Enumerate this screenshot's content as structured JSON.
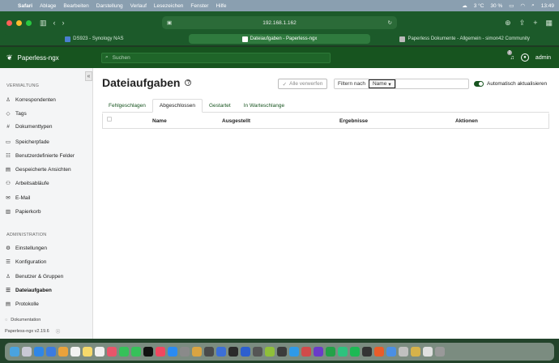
{
  "menubar": {
    "app": "Safari",
    "items": [
      "Ablage",
      "Bearbeiten",
      "Darstellung",
      "Verlauf",
      "Lesezeichen",
      "Fenster",
      "Hilfe"
    ],
    "weather": "3 °C",
    "battery": "30 %",
    "time": "13:49"
  },
  "browser": {
    "url": "192.168.1.162",
    "tabs": [
      {
        "label": "DS923 - Synology NAS"
      },
      {
        "label": "Dateiaufgaben - Paperless-ngx"
      },
      {
        "label": "Paperless Dokumente - Allgemein - simon42 Community"
      }
    ]
  },
  "header": {
    "brand": "Paperless-ngx",
    "search_placeholder": "Suchen",
    "notification_count": "2",
    "user": "admin"
  },
  "sidebar": {
    "section_manage": "VERWALTUNG",
    "manage_items": [
      {
        "label": "Korrespondenten",
        "icon": "person-icon"
      },
      {
        "label": "Tags",
        "icon": "tag-icon"
      },
      {
        "label": "Dokumenttypen",
        "icon": "hash-icon"
      },
      {
        "label": "Speicherpfade",
        "icon": "folder-icon"
      },
      {
        "label": "Benutzerdefinierte Felder",
        "icon": "ui-radios-icon"
      },
      {
        "label": "Gespeicherte Ansichten",
        "icon": "views-icon"
      },
      {
        "label": "Arbeitsabläufe",
        "icon": "flow-icon"
      },
      {
        "label": "E-Mail",
        "icon": "mail-icon"
      },
      {
        "label": "Papierkorb",
        "icon": "trash-icon"
      }
    ],
    "section_admin": "ADMINISTRATION",
    "admin_items": [
      {
        "label": "Einstellungen",
        "icon": "gear-icon"
      },
      {
        "label": "Konfiguration",
        "icon": "sliders-icon"
      },
      {
        "label": "Benutzer & Gruppen",
        "icon": "people-icon"
      },
      {
        "label": "Dateiaufgaben",
        "icon": "list-task-icon"
      },
      {
        "label": "Protokolle",
        "icon": "log-icon"
      }
    ],
    "doc_link": "Dokumentation",
    "version": "Paperless-ngx v2.19.6"
  },
  "main": {
    "title": "Dateiaufgaben",
    "dismiss_all": "Alle verwerfen",
    "filter_label": "Filtern nach",
    "filter_select": "Name",
    "auto_refresh": "Automatisch aktualisieren",
    "auto_refresh_on": true,
    "tabs": [
      {
        "label": "Fehlgeschlagen"
      },
      {
        "label": "Abgeschlossen"
      },
      {
        "label": "Gestartet"
      },
      {
        "label": "In Warteschlange"
      }
    ],
    "active_tab": "Abgeschlossen",
    "columns": [
      "Name",
      "Ausgestellt",
      "Ergebnisse",
      "Aktionen"
    ]
  },
  "colors": {
    "brand_green": "#17541f",
    "browser_green": "#1c5a2a"
  }
}
